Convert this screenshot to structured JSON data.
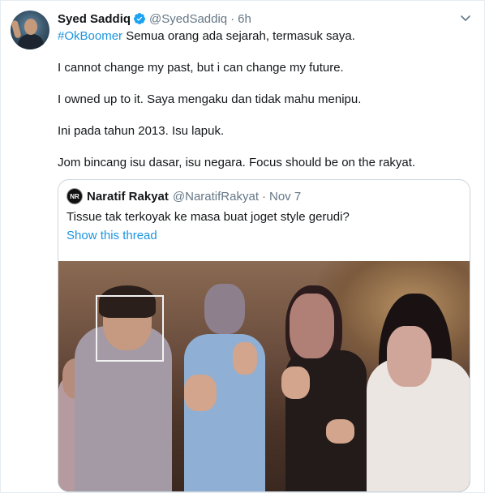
{
  "tweet": {
    "author_name": "Syed Saddiq",
    "handle": "@SyedSaddiq",
    "separator": "·",
    "time": "6h",
    "lines": [
      {
        "hashtag": "#OkBoomer",
        "text": " Semua orang ada sejarah, termasuk saya."
      },
      {
        "text": "I cannot change my past, but i can change my future."
      },
      {
        "text": "I owned up to it. Saya mengaku dan tidak mahu menipu."
      },
      {
        "text": "Ini pada tahun 2013. Isu lapuk."
      },
      {
        "text": "Jom bincang isu dasar, isu negara. Focus should be on the rakyat."
      }
    ]
  },
  "quoted_tweet": {
    "avatar_text": "NR",
    "author_name": "Naratif Rakyat",
    "handle": "@NaratifRakyat",
    "separator": "·",
    "time": "Nov 7",
    "text": "Tissue tak terkoyak ke masa buat joget style gerudi?",
    "show_thread": "Show this thread"
  },
  "icons": {
    "verified": "verified-badge-icon",
    "more": "chevron-down-icon"
  },
  "colors": {
    "link": "#1b95e0",
    "secondary_text": "#657786",
    "border": "#ccd6dd"
  }
}
